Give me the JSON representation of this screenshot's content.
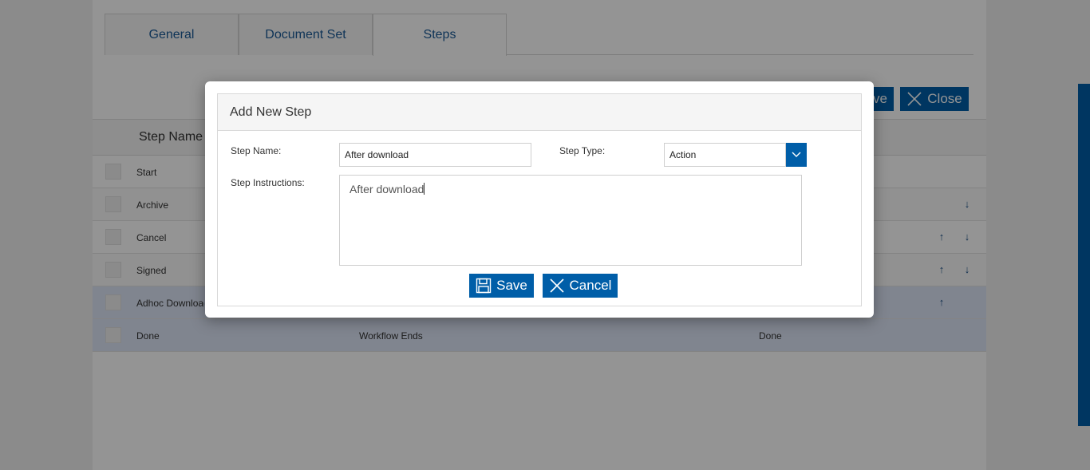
{
  "tabs": [
    {
      "label": "General"
    },
    {
      "label": "Document Set"
    },
    {
      "label": "Steps"
    }
  ],
  "toolbar": {
    "save_label_partial": "ve",
    "close_label": "Close"
  },
  "grid": {
    "column_step_name": "Step Name",
    "rows": [
      {
        "name": "Start",
        "description": "",
        "type": ""
      },
      {
        "name": "Archive",
        "description": "",
        "type": ""
      },
      {
        "name": "Cancel",
        "description": "",
        "type": ""
      },
      {
        "name": "Signed",
        "description": "",
        "type": ""
      },
      {
        "name": "Adhoc Download",
        "description": "",
        "type": ""
      },
      {
        "name": "Done",
        "description": "Workflow Ends",
        "type": "Done"
      }
    ]
  },
  "dialog": {
    "title": "Add New Step",
    "step_name_label": "Step Name:",
    "step_name_value": "After download",
    "step_type_label": "Step Type:",
    "step_type_value": "Action",
    "step_instructions_label": "Step Instructions:",
    "step_instructions_value": "After download",
    "save_label": "Save",
    "cancel_label": "Cancel"
  },
  "colors": {
    "accent": "#005ea8",
    "tab_text": "#1a5a97",
    "selected_row": "#dde6f6"
  }
}
